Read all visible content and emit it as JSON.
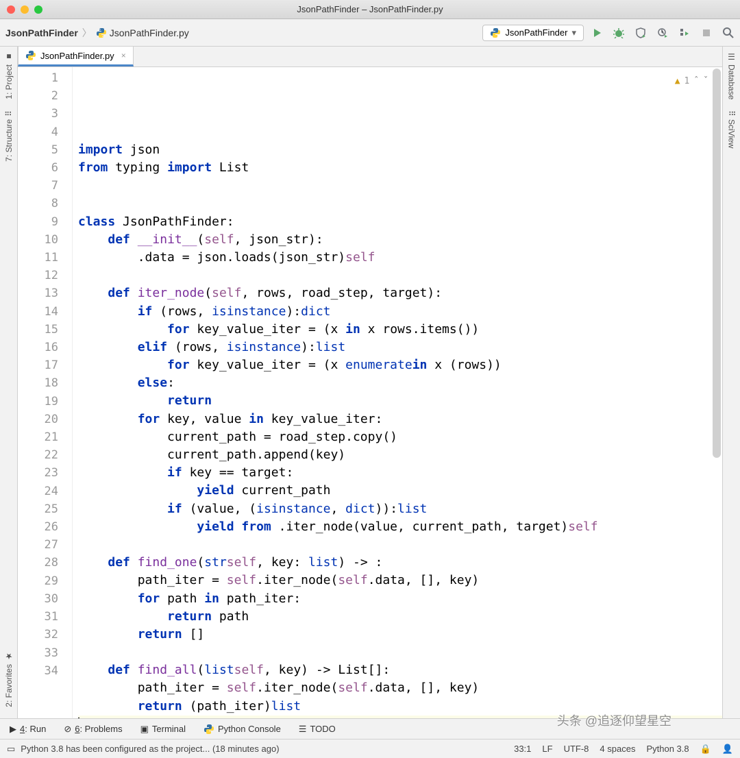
{
  "window": {
    "title": "JsonPathFinder – JsonPathFinder.py"
  },
  "breadcrumb": {
    "project": "JsonPathFinder",
    "file": "JsonPathFinder.py"
  },
  "run_config": {
    "label": "JsonPathFinder"
  },
  "editor_tab": {
    "label": "JsonPathFinder.py"
  },
  "inspection": {
    "warn_count": "1"
  },
  "left_tools": {
    "project": "1: Project",
    "structure": "7: Structure",
    "favorites": "2: Favorites"
  },
  "right_tools": {
    "database": "Database",
    "sciview": "SciView"
  },
  "bottom_tools": {
    "run": "4: Run",
    "problems": "6: Problems",
    "terminal": "Terminal",
    "python_console": "Python Console",
    "todo": "TODO"
  },
  "status": {
    "message": "Python 3.8 has been configured as the project... (18 minutes ago)",
    "cursor": "33:1",
    "line_sep": "LF",
    "encoding": "UTF-8",
    "indent": "4 spaces",
    "interpreter": "Python 3.8"
  },
  "line_numbers": [
    "1",
    "2",
    "3",
    "4",
    "5",
    "6",
    "7",
    "8",
    "9",
    "10",
    "11",
    "12",
    "13",
    "14",
    "15",
    "16",
    "17",
    "18",
    "19",
    "20",
    "21",
    "22",
    "23",
    "24",
    "25",
    "26",
    "27",
    "28",
    "29",
    "30",
    "31",
    "32",
    "33",
    "34"
  ],
  "code": {
    "l1": {
      "kw1": "import",
      "t1": " json"
    },
    "l2": {
      "kw1": "from",
      "t1": " typing ",
      "kw2": "import",
      "t2": " List"
    },
    "l3": "",
    "l4": "",
    "l5": {
      "kw1": "class",
      "t1": " JsonPathFinder:"
    },
    "l6": {
      "pre": "    ",
      "kw1": "def ",
      "fn": "__init__",
      "t1": "(",
      "self": "self",
      "t2": ", json_str):"
    },
    "l7": {
      "pre": "        ",
      "self": "self",
      "t1": ".data = json.loads(json_str)"
    },
    "l8": "",
    "l9": {
      "pre": "    ",
      "kw1": "def ",
      "fn": "iter_node",
      "t1": "(",
      "self": "self",
      "t2": ", rows, road_step, target):"
    },
    "l10": {
      "pre": "        ",
      "kw1": "if ",
      "bi": "isinstance",
      "t1": "(rows, ",
      "bi2": "dict",
      "t2": "):"
    },
    "l11": {
      "pre": "            ",
      "t1": "key_value_iter = (x ",
      "kw1": "for ",
      "t2": "x ",
      "kw2": "in ",
      "t3": "rows.items())"
    },
    "l12": {
      "pre": "        ",
      "kw1": "elif ",
      "bi": "isinstance",
      "t1": "(rows, ",
      "bi2": "list",
      "t2": "):"
    },
    "l13": {
      "pre": "            ",
      "t1": "key_value_iter = (x ",
      "kw1": "for ",
      "t2": "x ",
      "kw2": "in ",
      "bi": "enumerate",
      "t3": "(rows))"
    },
    "l14": {
      "pre": "        ",
      "kw1": "else",
      "t1": ":"
    },
    "l15": {
      "pre": "            ",
      "kw1": "return"
    },
    "l16": {
      "pre": "        ",
      "kw1": "for ",
      "t1": "key, value ",
      "kw2": "in ",
      "t2": "key_value_iter:"
    },
    "l17": {
      "pre": "            ",
      "t1": "current_path = road_step.copy()"
    },
    "l18": {
      "pre": "            ",
      "t1": "current_path.append(key)"
    },
    "l19": {
      "pre": "            ",
      "kw1": "if ",
      "t1": "key == target:"
    },
    "l20": {
      "pre": "                ",
      "kw1": "yield ",
      "t1": "current_path"
    },
    "l21": {
      "pre": "            ",
      "kw1": "if ",
      "bi": "isinstance",
      "t1": "(value, (",
      "bi2": "dict",
      "t2": ", ",
      "bi3": "list",
      "t3": ")):"
    },
    "l22": {
      "pre": "                ",
      "kw1": "yield from ",
      "self": "self",
      "t1": ".iter_node(value, current_path, target)"
    },
    "l23": "",
    "l24": {
      "pre": "    ",
      "kw1": "def ",
      "fn": "find_one",
      "t1": "(",
      "self": "self",
      "t2": ", key: ",
      "bi": "str",
      "t3": ") -> ",
      "bi2": "list",
      "t4": ":"
    },
    "l25": {
      "pre": "        ",
      "t1": "path_iter = ",
      "self": "self",
      "t2": ".iter_node(",
      "self2": "self",
      "t3": ".data, [], key)"
    },
    "l26": {
      "pre": "        ",
      "kw1": "for ",
      "t1": "path ",
      "kw2": "in ",
      "t2": "path_iter:"
    },
    "l27": {
      "pre": "            ",
      "kw1": "return ",
      "t1": "path"
    },
    "l28": {
      "pre": "        ",
      "kw1": "return ",
      "t1": "[]"
    },
    "l29": "",
    "l30": {
      "pre": "    ",
      "kw1": "def ",
      "fn": "find_all",
      "t1": "(",
      "self": "self",
      "t2": ", key) -> List[",
      "bi": "list",
      "t3": "]:"
    },
    "l31": {
      "pre": "        ",
      "t1": "path_iter = ",
      "self": "self",
      "t2": ".iter_node(",
      "self2": "self",
      "t3": ".data, [], key)"
    },
    "l32": {
      "pre": "        ",
      "kw1": "return ",
      "bi": "list",
      "t1": "(path_iter)"
    },
    "l33": "",
    "l34": ""
  },
  "watermark": "头条 @追逐仰望星空"
}
